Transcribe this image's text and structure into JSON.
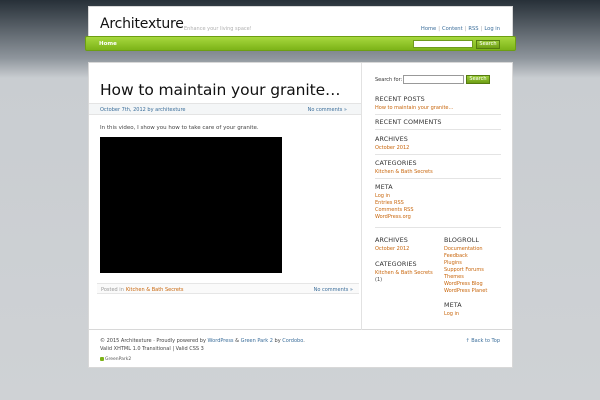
{
  "header": {
    "site_title": "Architexture",
    "site_desc": "Enhance your living space!",
    "links": [
      "Home",
      "Content",
      "RSS",
      "Log in"
    ]
  },
  "nav": {
    "home_label": "Home",
    "search_button": "Search"
  },
  "post": {
    "title": "How to maintain your granite…",
    "date_author": "October 7th, 2012 by architexture",
    "comments": "No comments »",
    "body": "In this video, I show you how to take care of your granite.",
    "posted_in": "Posted in",
    "category": "Kitchen & Bath Secrets",
    "foot_comments": "No comments »"
  },
  "sidebar": {
    "search_label": "Search for:",
    "search_button": "Search",
    "recent_posts_title": "RECENT POSTS",
    "recent_posts": [
      "How to maintain your granite…"
    ],
    "recent_comments_title": "RECENT COMMENTS",
    "archives_title": "ARCHIVES",
    "archives": [
      "October 2012"
    ],
    "categories_title": "CATEGORIES",
    "categories": [
      "Kitchen & Bath Secrets"
    ],
    "meta_title": "META",
    "meta": [
      "Log in",
      "Entries RSS",
      "Comments RSS",
      "WordPress.org"
    ],
    "archives2_title": "ARCHIVES",
    "archives2": [
      "October 2012"
    ],
    "categories2_title": "CATEGORIES",
    "categories2": [
      "Kitchen & Bath Secrets"
    ],
    "categories2_count": "(1)",
    "blogroll_title": "BLOGROLL",
    "blogroll": [
      "Documentation",
      "Feedback",
      "Plugins",
      "Support Forums",
      "Themes",
      "WordPress Blog",
      "WordPress Planet"
    ],
    "meta2_title": "META",
    "meta2": [
      "Log in"
    ]
  },
  "footer": {
    "copyright": "© 2015 Architexture · Proudly powered by",
    "wordpress": "WordPress",
    "amp": "&",
    "greenpark": "Green Park 2",
    "by": "by",
    "author": "Cordobo",
    "period": ".",
    "valid": "Valid XHTML 1.0 Transitional | Valid CSS 3",
    "back_to_top": "↑ Back to Top",
    "badge": "GreenPark2"
  },
  "colors": {
    "accent_green": "#7cb318",
    "link_orange": "#c8650a",
    "link_blue": "#3a6d9a"
  }
}
